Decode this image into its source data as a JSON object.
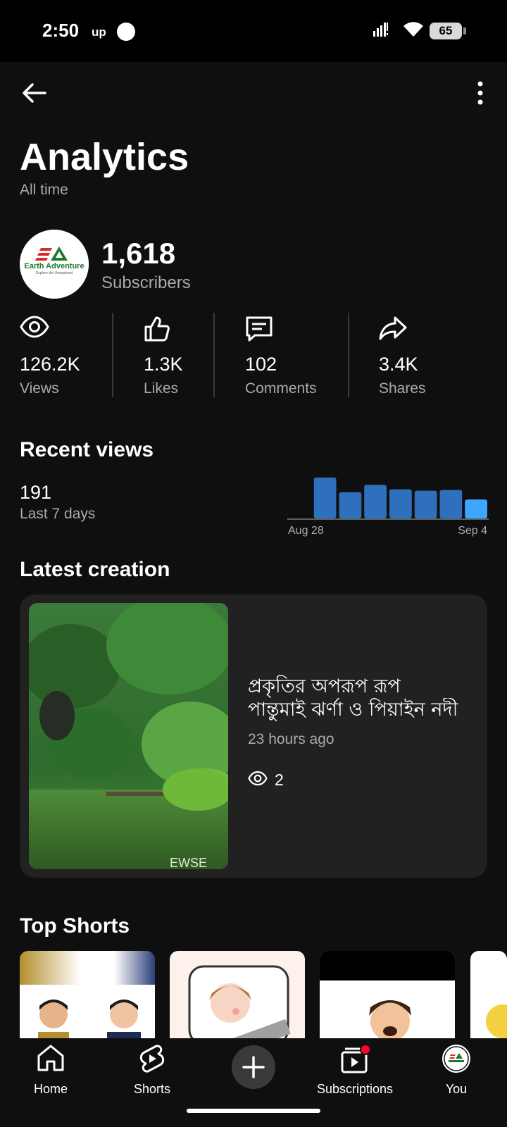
{
  "status_bar": {
    "time": "2:50",
    "carrier_badge": "up",
    "battery": "65"
  },
  "header": {
    "title": "Analytics",
    "subtitle": "All time"
  },
  "channel": {
    "avatar_brand": "Earth Adventure",
    "avatar_tagline": "Explore the Unexplored",
    "subscriber_count": "1,618",
    "subscriber_label": "Subscribers"
  },
  "stats": [
    {
      "icon": "eye-icon",
      "value": "126.2K",
      "label": "Views"
    },
    {
      "icon": "thumbs-up-icon",
      "value": "1.3K",
      "label": "Likes"
    },
    {
      "icon": "comment-icon",
      "value": "102",
      "label": "Comments"
    },
    {
      "icon": "share-icon",
      "value": "3.4K",
      "label": "Shares"
    }
  ],
  "recent_views": {
    "title": "Recent views",
    "count": "191",
    "period": "Last 7 days",
    "chart_data": {
      "type": "bar",
      "x_start_label": "Aug 28",
      "x_end_label": "Sep 4",
      "values": [
        0,
        56,
        36,
        46,
        40,
        38,
        39,
        26
      ],
      "highlight_last": true,
      "colors": {
        "bar": "#2e6fbe",
        "highlight": "#3ea6ff",
        "baseline": "#606060"
      }
    }
  },
  "latest_creation": {
    "section_title": "Latest creation",
    "title_line1": "প্রকৃতির অপরূপ রূপ",
    "title_line2": "পান্তুমাই ঝর্ণা ও পিয়াইন নদী",
    "time_ago": "23 hours ago",
    "views": "2",
    "thumbnail_watermark": "EWSE"
  },
  "top_shorts": {
    "title": "Top Shorts"
  },
  "bottom_nav": [
    {
      "icon": "home-icon",
      "label": "Home"
    },
    {
      "icon": "shorts-icon",
      "label": "Shorts"
    },
    {
      "icon": "plus-icon",
      "label": ""
    },
    {
      "icon": "subscriptions-icon",
      "label": "Subscriptions"
    },
    {
      "icon": "avatar-icon",
      "label": "You"
    }
  ],
  "colors": {
    "background": "#0f0f0f",
    "card": "#212121",
    "secondary_text": "#aaaaaa",
    "accent_blue": "#3ea6ff",
    "notification_red": "#ff0033"
  }
}
